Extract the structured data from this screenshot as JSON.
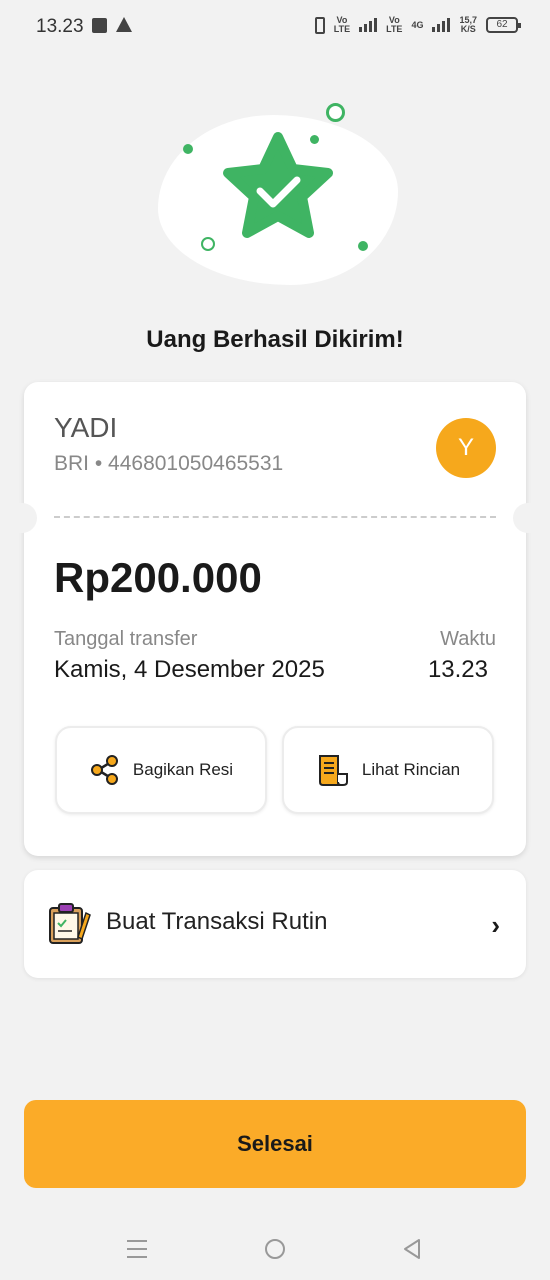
{
  "status_bar": {
    "time": "13.23",
    "lte1": "Vo",
    "lte1_sub": "LTE",
    "lte2": "Vo",
    "lte2_sub": "LTE",
    "network": "4G",
    "speed": "15,7",
    "speed_unit": "K/S",
    "battery": "62"
  },
  "header": {
    "title": "Uang Berhasil Dikirim!"
  },
  "recipient": {
    "name": "YADI",
    "account": "BRI • 446801050465531",
    "avatar_initial": "Y"
  },
  "transfer": {
    "amount": "Rp200.000",
    "date_label": "Tanggal transfer",
    "date_value": "Kamis, 4 Desember 2025",
    "time_label": "Waktu",
    "time_value": "13.23"
  },
  "actions": {
    "share_label": "Bagikan Resi",
    "detail_label": "Lihat Rincian"
  },
  "routine": {
    "label": "Buat Transaksi Rutin"
  },
  "primary": {
    "done_label": "Selesai"
  },
  "colors": {
    "accent": "#fbab28",
    "success": "#3fb463",
    "avatar": "#f6a81c"
  }
}
